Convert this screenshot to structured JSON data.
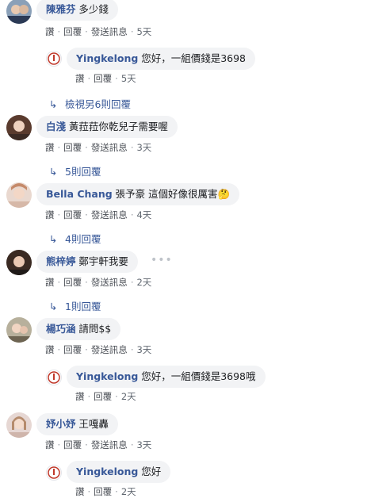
{
  "comments": [
    {
      "name": "陳雅芬",
      "text": "多少錢",
      "meta": {
        "like": "讚",
        "reply": "回覆",
        "message": "發送訊息",
        "time": "5天"
      }
    },
    {
      "name": "白淺",
      "text": "黃菈菈你乾兒子需要喔",
      "meta": {
        "like": "讚",
        "reply": "回覆",
        "message": "發送訊息",
        "time": "3天"
      },
      "more": "5則回覆"
    },
    {
      "name": "Bella Chang",
      "text": "張予豪 這個好像很厲害🤔",
      "meta": {
        "like": "讚",
        "reply": "回覆",
        "message": "發送訊息",
        "time": "4天"
      },
      "more": "4則回覆"
    },
    {
      "name": "熊梓婷",
      "text": "鄭宇軒我要",
      "meta": {
        "like": "讚",
        "reply": "回覆",
        "message": "發送訊息",
        "time": "2天"
      },
      "more": "1則回覆"
    },
    {
      "name": "楊巧涵",
      "text": "請問$$",
      "meta": {
        "like": "讚",
        "reply": "回覆",
        "message": "發送訊息",
        "time": "3天"
      }
    },
    {
      "name": "妤小妤",
      "text": "王嘎轟",
      "meta": {
        "like": "讚",
        "reply": "回覆",
        "message": "發送訊息",
        "time": "3天"
      }
    }
  ],
  "replies": [
    {
      "name": "Yingkelong",
      "text": "您好，一組價錢是3698",
      "like": "讚",
      "reply": "回覆",
      "time": "5天"
    },
    {
      "name": "Yingkelong",
      "text": "您好，一組價錢是3698哦",
      "like": "讚",
      "reply": "回覆",
      "time": "2天"
    },
    {
      "name": "Yingkelong",
      "text": "您好",
      "like": "讚",
      "reply": "回覆",
      "time": "2天"
    }
  ],
  "view_more_replies": "檢視另6則回覆",
  "colors": {
    "name": "#385898",
    "bubble": "#f2f3f5",
    "meta": "#606770"
  }
}
